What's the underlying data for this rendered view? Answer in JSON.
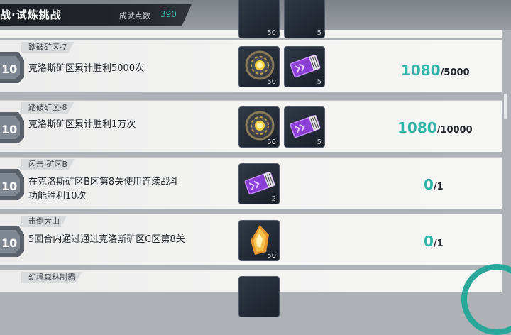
{
  "header": {
    "title": "战·试炼挑战",
    "points_label": "成就点数",
    "points_value": "390"
  },
  "stub_row": {
    "reward_qty_1": "50",
    "reward_qty_2": "5"
  },
  "rows": [
    {
      "category": "踏破矿区·7",
      "desc_line1": "克洛斯矿区累计胜利5000次",
      "desc_line2": "",
      "badge": "10",
      "rewards": [
        {
          "icon": "core-chip-icon",
          "qty": "50"
        },
        {
          "icon": "purple-ticket-icon",
          "qty": "5"
        }
      ],
      "current": "1080",
      "total": "/5000"
    },
    {
      "category": "踏破矿区·8",
      "desc_line1": "克洛斯矿区累计胜利1万次",
      "desc_line2": "",
      "badge": "10",
      "rewards": [
        {
          "icon": "core-chip-icon",
          "qty": "50"
        },
        {
          "icon": "purple-ticket-icon",
          "qty": "5"
        }
      ],
      "current": "1080",
      "total": "/10000"
    },
    {
      "category": "闪击·矿区B",
      "desc_line1": "在克洛斯矿区B区第8关使用连续战斗",
      "desc_line2": "功能胜利10次",
      "badge": "10",
      "rewards": [
        {
          "icon": "purple-ticket-icon",
          "qty": "2"
        }
      ],
      "current": "0",
      "total": "/1"
    },
    {
      "category": "击倒大山",
      "desc_line1": "5回合内通过通过克洛斯矿区C区第8关",
      "desc_line2": "",
      "badge": "10",
      "rewards": [
        {
          "icon": "fire-crystal-icon",
          "qty": "50"
        }
      ],
      "current": "0",
      "total": "/1"
    },
    {
      "category": "幻境森林制霸"
    }
  ],
  "colors": {
    "accent": "#2fb3a6",
    "ticket": "#8b3fd6",
    "header": "#23272d"
  }
}
